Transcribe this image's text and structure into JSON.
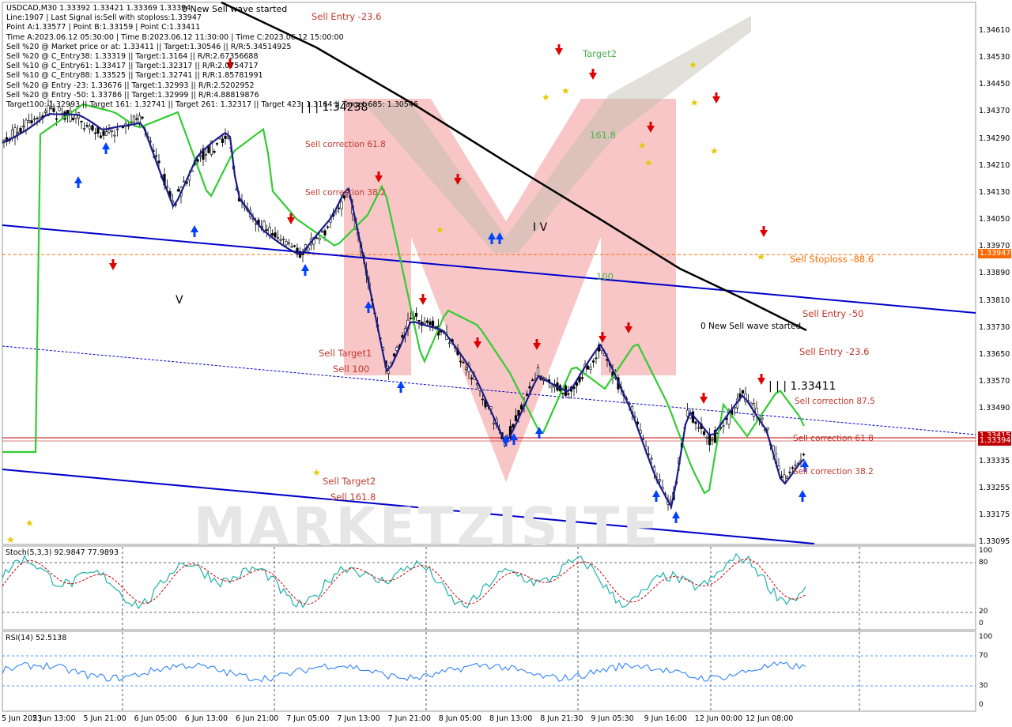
{
  "header": {
    "symbol_line": "USDCAD,M30  1.33392 1.33421 1.33369 1.33394",
    "info_lines": [
      "Line:1907 | Last Signal is:Sell with stoploss:1.33947",
      "Point A:1.33577 | Point B:1.33159 | Point C:1.33411",
      "Time A:2023.06.12 05:30:00 | Time B:2023.06.12 11:30:00 | Time C:2023.06.12 15:00:00",
      "Sell %20 @ Market price or at: 1.33411 || Target:1.30546 || R/R:5.34514925",
      "Sell %20 @ C_Entry38: 1.33319 || Target:1.3164 || R/R:2.67356688",
      "Sell %10 @ C_Entry61: 1.33417 || Target:1.32317 || R/R:2.0754717",
      "Sell %10 @ C_Entry88: 1.33525 || Target:1.32741 || R/R:1.85781991",
      "Sell %20 @ Entry -23: 1.33676 || Target:1.32993 || R/R:2.5202952",
      "Sell %20 @ Entry -50: 1.33786 || Target:1.32999 || R/R:4.88819876",
      "Target100: 1.32993 || Target 161: 1.32741 || Target 261: 1.32317 || Target 423: 1.3164 || Target 685: 1.30546"
    ],
    "wave_started_top": "0 New Sell wave started"
  },
  "price_axis": {
    "labels": [
      "1.34610",
      "1.34530",
      "1.34450",
      "1.34370",
      "1.34290",
      "1.34210",
      "1.34130",
      "1.34050",
      "1.33970",
      "1.33890",
      "1.33810",
      "1.33730",
      "1.33650",
      "1.33570",
      "1.33490",
      "1.33335",
      "1.33255",
      "1.33175",
      "1.33095"
    ],
    "stoploss_tag": "1.33947",
    "current_tag": "1.33394",
    "hidden_tag": "1.33415"
  },
  "time_axis": {
    "labels": [
      "5 Jun 2023",
      "5 Jun 13:00",
      "5 Jun 21:00",
      "6 Jun 05:00",
      "6 Jun 13:00",
      "6 Jun 21:00",
      "7 Jun 05:00",
      "7 Jun 13:00",
      "7 Jun 21:00",
      "8 Jun 05:00",
      "8 Jun 13:00",
      "8 Jun 21:30",
      "9 Jun 05:30",
      "9 Jun 16:00",
      "12 Jun 00:00",
      "12 Jun 08:00"
    ]
  },
  "annotations": {
    "sell_entry_top": "Sell Entry -23.6",
    "target2": "Target2",
    "fib_1618_top": "161.8",
    "level_top": "| | | 1.34238",
    "sell_correction_618_left": "Sell correction 61.8",
    "sell_correction_382_left": "Sell correction 38.2",
    "wave_iv": "I V",
    "wave_v": "V",
    "fib_100": "100",
    "sell_stoploss": "Sell Stoploss -88.6",
    "sell_entry_50": "Sell Entry -50",
    "new_wave_right": "0 New Sell wave started",
    "sell_entry_236_right": "Sell Entry -23.6",
    "sell_target1": "Sell Target1",
    "sell_100": "Sell 100",
    "level_c": "| | | 1.33411",
    "sell_correction_875": "Sell correction 87.5",
    "sell_correction_618_right": "Sell correction 61.8",
    "sell_correction_382_right": "Sell correction 38.2",
    "sell_target2": "Sell Target2",
    "sell_1618": "Sell 161.8"
  },
  "stoch": {
    "label": "Stoch(5,3,3) 92.9847 77.9893",
    "levels": [
      "100",
      "80",
      "20",
      "0"
    ]
  },
  "rsi": {
    "label": "RSI(14) 52.5138",
    "levels": [
      "100",
      "70",
      "30",
      "0"
    ]
  },
  "watermark": "MARKETZISITE",
  "colors": {
    "stoploss": "#ff6a00",
    "current": "#c00000",
    "ma_fast": "#1b1b8a",
    "ma_slow": "#33cc33",
    "trend_black": "#000000",
    "channel": "#0000cc",
    "bull_candle": "#ffffff",
    "bear_candle": "#000000",
    "stoch_main": "#20b2aa",
    "stoch_signal": "#cc0000",
    "rsi": "#1e78ff",
    "pink": "#f08080"
  },
  "chart_data": {
    "type": "candlestick",
    "symbol": "USDCAD",
    "timeframe": "M30",
    "last": {
      "open": 1.33392,
      "high": 1.33421,
      "low": 1.33369,
      "close": 1.33394
    },
    "ylim": [
      1.33095,
      1.3461
    ],
    "levels": {
      "point_a": 1.33577,
      "point_b": 1.33159,
      "point_c": 1.33411,
      "stoploss": 1.33947,
      "entry_market": 1.33411,
      "entry_c38": 1.33319,
      "entry_c61": 1.33417,
      "entry_c88": 1.33525,
      "entry_m23": 1.33676,
      "entry_m50": 1.33786,
      "target_100": 1.32993,
      "target_161": 1.32741,
      "target_261": 1.32317,
      "target_423": 1.3164,
      "target_685": 1.30546
    },
    "stoch": {
      "k": 92.9847,
      "d": 77.9893
    },
    "rsi": 52.5138
  }
}
